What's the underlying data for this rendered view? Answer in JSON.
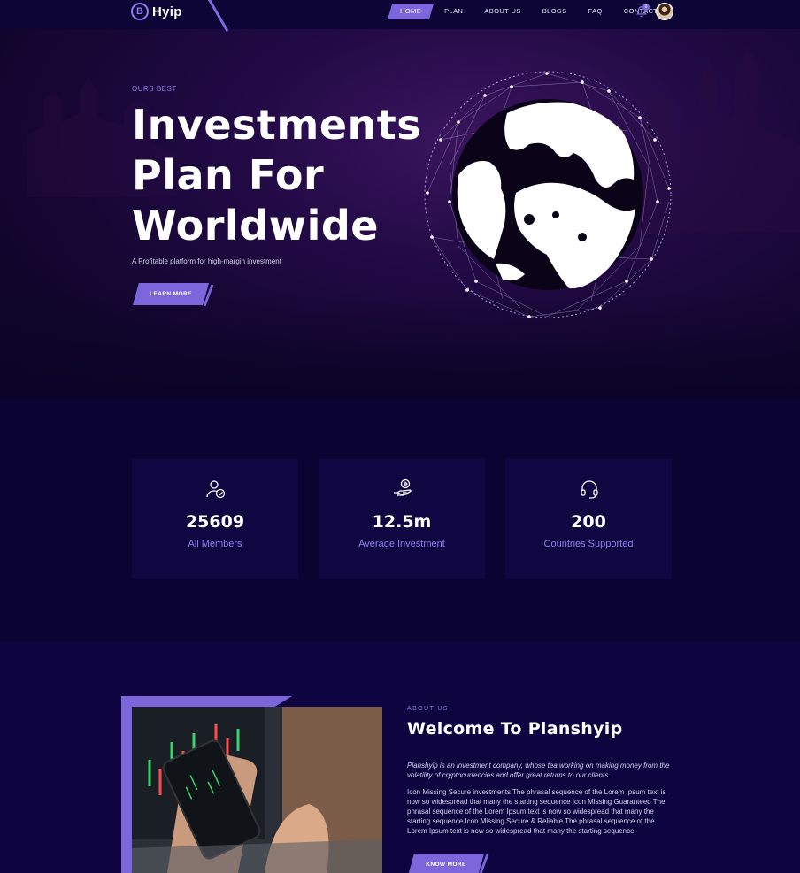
{
  "brand": {
    "icon_letter": "B",
    "name": "Hyip"
  },
  "nav": {
    "items": [
      {
        "label": "HOME",
        "active": true
      },
      {
        "label": "PLAN",
        "active": false
      },
      {
        "label": "ABOUT US",
        "active": false
      },
      {
        "label": "BLOGS",
        "active": false
      },
      {
        "label": "FAQ",
        "active": false
      },
      {
        "label": "CONTACT",
        "active": false
      }
    ],
    "notification_icon": "bell-icon",
    "notification_count": "0",
    "avatar_icon": "user-avatar"
  },
  "hero": {
    "eyebrow": "OURS BEST",
    "title_line1": "Investments",
    "title_line2": "Plan For",
    "title_line3": "Worldwide",
    "subtitle": "A Profitable platform for high-margin investment",
    "button_label": "LEARN MORE"
  },
  "stats": [
    {
      "icon": "user-check-icon",
      "value": "25609",
      "label": "All Members"
    },
    {
      "icon": "hand-coin-icon",
      "value": "12.5m",
      "label": "Average Investment"
    },
    {
      "icon": "headset-icon",
      "value": "200",
      "label": "Countries Supported"
    }
  ],
  "about": {
    "eyebrow": "ABOUT US",
    "title": "Welcome To Planshyip",
    "intro": "Planshyip is an investment company, whose tea working on making money from the volatility of cryptocurrencies and offer great returns to our clients.",
    "body": "Icon Missing Secure investments The phrasal sequence of the Lorem Ipsum text is now so widespread that many the starting sequence Icon Missing Guaranteed The phrasal sequence of the Lorem Ipsum text is now so widespread that many the starting sequence Icon Missing Secure & Reliable The phrasal sequence of the Lorem Ipsum text is now so widespread that many the starting sequence",
    "button_label": "KNOW MORE"
  },
  "colors": {
    "accent": "#7b66dc",
    "accent_text": "#8f7cf0",
    "background": "#0b0430"
  }
}
